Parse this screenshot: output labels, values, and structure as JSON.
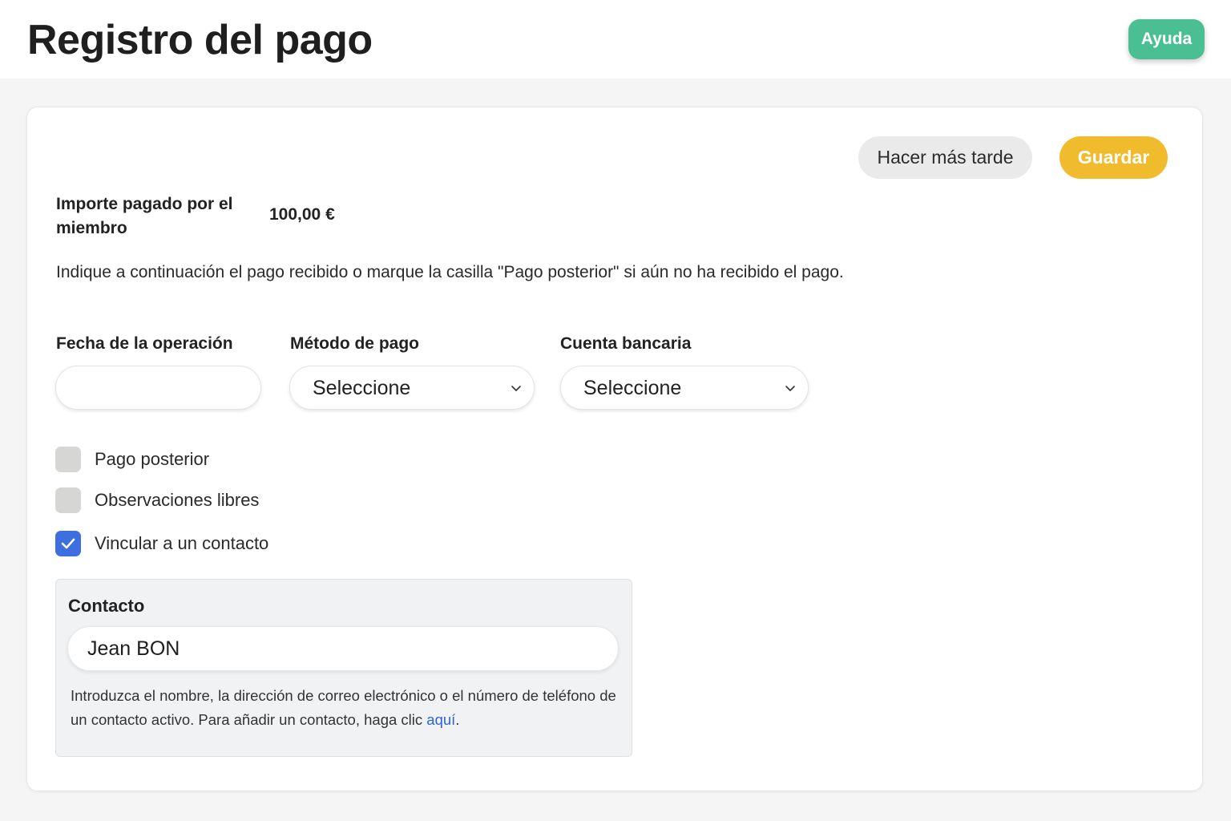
{
  "header": {
    "title": "Registro del pago",
    "help_label": "Ayuda"
  },
  "actions": {
    "later_label": "Hacer más tarde",
    "save_label": "Guardar"
  },
  "amount": {
    "label": "Importe pagado por el miembro",
    "value": "100,00 €"
  },
  "instruction": "Indique a continuación el pago recibido o marque la casilla \"Pago posterior\" si aún no ha recibido el pago.",
  "fields": {
    "date": {
      "label": "Fecha de la operación",
      "value": ""
    },
    "method": {
      "label": "Método de pago",
      "value": "Seleccione"
    },
    "account": {
      "label": "Cuenta bancaria",
      "value": "Seleccione"
    }
  },
  "checkboxes": [
    {
      "label": "Pago posterior",
      "checked": false
    },
    {
      "label": "Observaciones libres",
      "checked": false
    },
    {
      "label": "Vincular a un contacto",
      "checked": true
    }
  ],
  "contact": {
    "title": "Contacto",
    "value": "Jean BON",
    "help_text": "Introduzca el nombre, la dirección de correo electrónico o el número de teléfono de un contacto activo. Para añadir un contacto, haga clic ",
    "link_text": "aquí",
    "help_end": "."
  },
  "colors": {
    "help_button": "#4bbf94",
    "save_button": "#f0bb2c",
    "checkbox_checked": "#3d6fe0",
    "link": "#2f64d6"
  }
}
